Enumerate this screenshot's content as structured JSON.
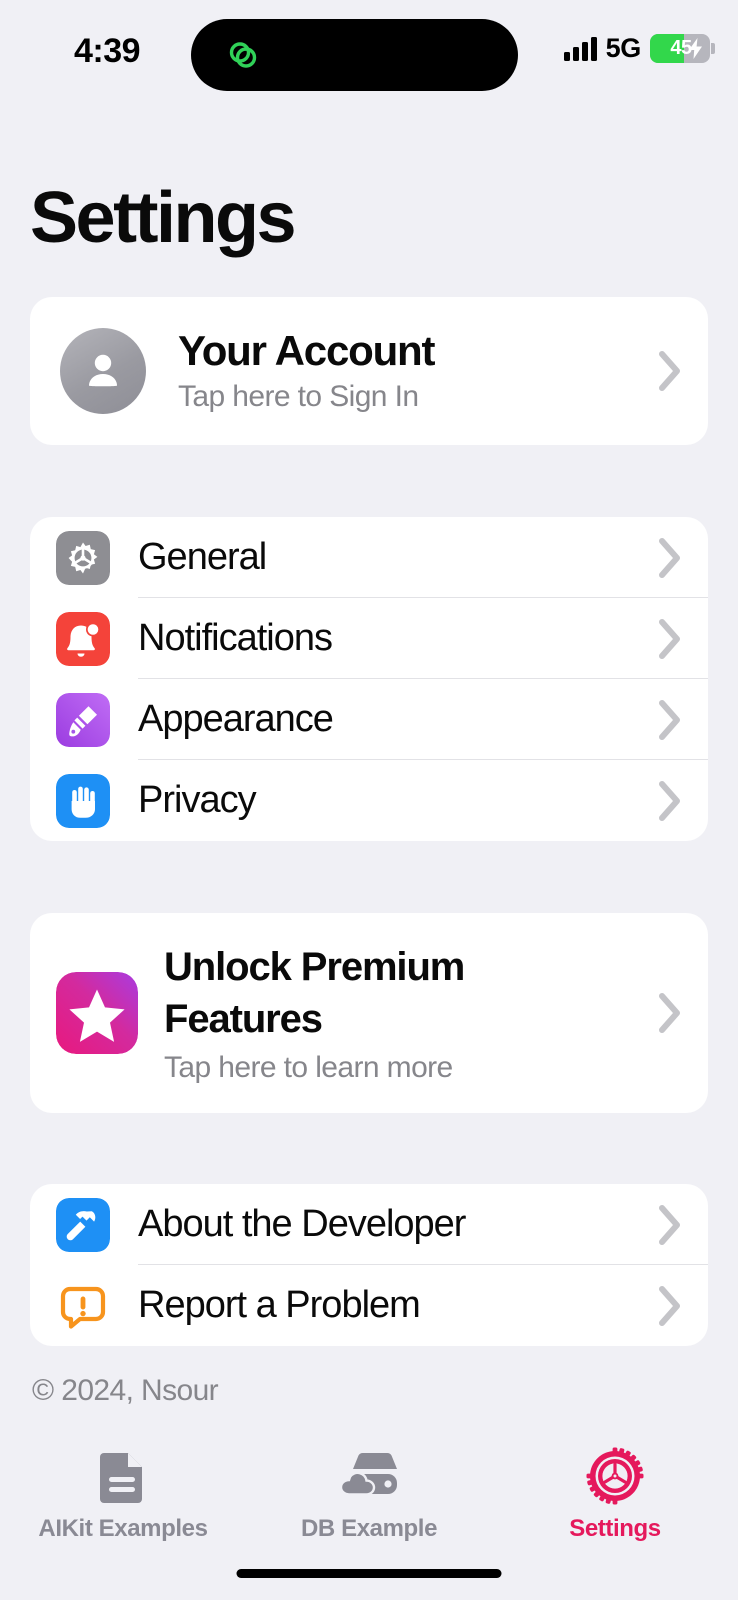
{
  "status_bar": {
    "time": "4:39",
    "network": "5G",
    "battery_level": "45",
    "battery_percent": 45,
    "charging": true,
    "signal_bars": 4,
    "island_icon": "link-loop-icon",
    "accent_green": "#32d74b"
  },
  "header": {
    "title": "Settings"
  },
  "account": {
    "title": "Your Account",
    "subtitle": "Tap here to Sign In",
    "avatar_icon": "person-icon"
  },
  "main_menu": {
    "items": [
      {
        "label": "General",
        "icon": "gear-icon",
        "color": "#8e8e93"
      },
      {
        "label": "Notifications",
        "icon": "bell-icon",
        "color": "#f4433a"
      },
      {
        "label": "Appearance",
        "icon": "paintbrush-icon",
        "color": "#a457e8"
      },
      {
        "label": "Privacy",
        "icon": "hand-raised-icon",
        "color": "#1e90f5"
      }
    ]
  },
  "premium": {
    "title": "Unlock Premium Features",
    "subtitle": "Tap here to learn more",
    "icon": "star-icon",
    "gradient_from": "#a93ce0",
    "gradient_to": "#e8197e"
  },
  "about_menu": {
    "items": [
      {
        "label": "About the Developer",
        "icon": "hammer-icon",
        "color": "#1e90f5"
      },
      {
        "label": "Report a Problem",
        "icon": "exclamation-bubble-icon",
        "color": "#f7941d"
      }
    ]
  },
  "footer": {
    "copyright": "© 2024, Nsour"
  },
  "tab_bar": {
    "active_color": "#e5195c",
    "inactive_color": "#8a8a94",
    "tabs": [
      {
        "label": "AIKit Examples",
        "icon": "document-icon",
        "active": false
      },
      {
        "label": "DB Example",
        "icon": "database-cloud-icon",
        "active": false
      },
      {
        "label": "Settings",
        "icon": "gear-icon",
        "active": true
      }
    ]
  }
}
